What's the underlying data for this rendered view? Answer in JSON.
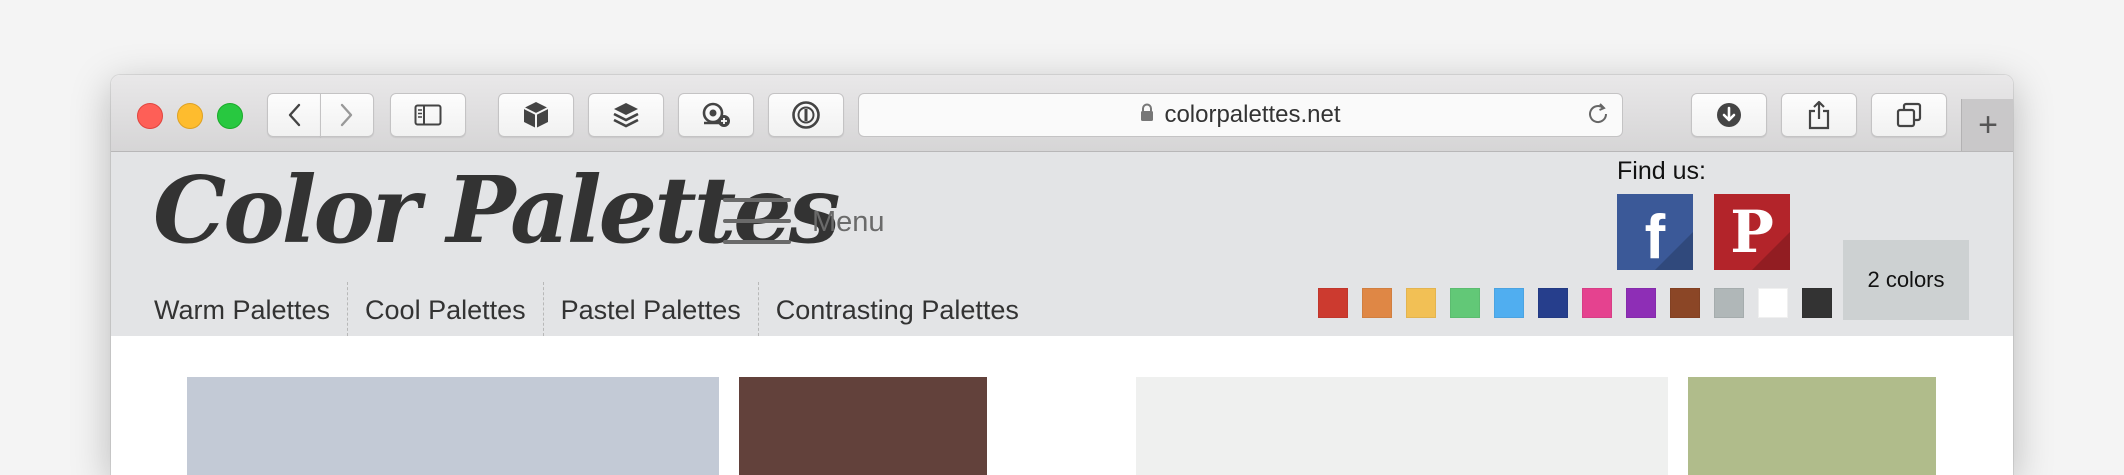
{
  "browser": {
    "url": "colorpalettes.net",
    "new_tab_symbol": "+"
  },
  "site": {
    "logo": "Color Palettes",
    "menu_label": "Menu",
    "find_us_label": "Find us:",
    "social": {
      "facebook_glyph": "f",
      "pinterest_glyph": "P"
    },
    "nav": [
      "Warm Palettes",
      "Cool Palettes",
      "Pastel Palettes",
      "Contrasting Palettes"
    ],
    "swatches": [
      {
        "name": "red",
        "color": "#cc3a2f"
      },
      {
        "name": "orange",
        "color": "#df8745"
      },
      {
        "name": "yellow",
        "color": "#f2c055"
      },
      {
        "name": "green",
        "color": "#62c877"
      },
      {
        "name": "light-blue",
        "color": "#50aef0"
      },
      {
        "name": "navy",
        "color": "#263e8c"
      },
      {
        "name": "pink",
        "color": "#e5428f"
      },
      {
        "name": "purple",
        "color": "#8e2eb6"
      },
      {
        "name": "brown",
        "color": "#8b4626"
      },
      {
        "name": "gray",
        "color": "#b0b7b8"
      },
      {
        "name": "white",
        "color": "#ffffff"
      },
      {
        "name": "black",
        "color": "#333333"
      }
    ],
    "colors_button": "2 colors"
  },
  "thumbnails": [
    {
      "name": "photo-thumbnail-1",
      "color": "#c3cad6"
    },
    {
      "name": "palette-swatch-brown",
      "color": "#62413b"
    },
    {
      "name": "photo-thumbnail-2",
      "color": "#eff0ef"
    },
    {
      "name": "palette-swatch-sage",
      "color": "#b0bc8b"
    }
  ]
}
